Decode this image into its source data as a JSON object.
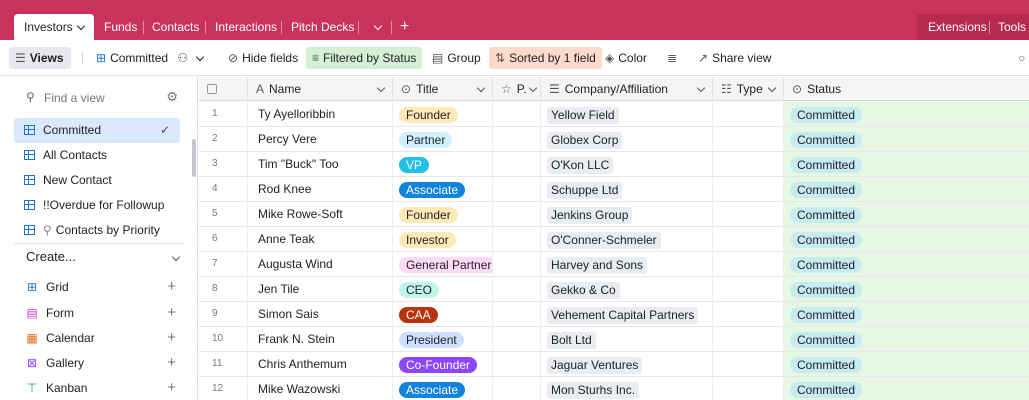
{
  "tabs": {
    "active": "Investors",
    "items": [
      "Funds",
      "Contacts",
      "Interactions",
      "Pitch Decks"
    ],
    "add": "+",
    "right": [
      "Extensions",
      "Tools"
    ]
  },
  "toolbar": {
    "views": "Views",
    "current_view": "Committed",
    "hide_fields": "Hide fields",
    "filter": "Filtered by Status",
    "group": "Group",
    "sort": "Sorted by 1 field",
    "color": "Color",
    "share": "Share view"
  },
  "sidebar": {
    "search_placeholder": "Find a view",
    "views": [
      {
        "label": "Committed",
        "selected": true
      },
      {
        "label": "All Contacts"
      },
      {
        "label": "New Contact"
      },
      {
        "label": "!!Overdue for Followup"
      },
      {
        "label": "Contacts by Priority"
      }
    ],
    "create_label": "Create...",
    "create_items": [
      {
        "label": "Grid",
        "icon": "grid-icon"
      },
      {
        "label": "Form",
        "icon": "form-icon"
      },
      {
        "label": "Calendar",
        "icon": "calendar-icon"
      },
      {
        "label": "Gallery",
        "icon": "gallery-icon"
      },
      {
        "label": "Kanban",
        "icon": "kanban-icon"
      }
    ]
  },
  "grid": {
    "columns": [
      "Name",
      "Title",
      "P.",
      "Company/Affiliation",
      "Type",
      "Status"
    ],
    "rows": [
      {
        "num": "1",
        "name": "Ty Ayelloribbin",
        "title": "Founder",
        "company": "Yellow Field",
        "status": "Committed"
      },
      {
        "num": "2",
        "name": "Percy Vere",
        "title": "Partner",
        "company": "Globex Corp",
        "status": "Committed"
      },
      {
        "num": "3",
        "name": "Tim \"Buck\" Too",
        "title": "VP",
        "company": "O'Kon LLC",
        "status": "Committed"
      },
      {
        "num": "4",
        "name": "Rod Knee",
        "title": "Associate",
        "company": "Schuppe Ltd",
        "status": "Committed"
      },
      {
        "num": "5",
        "name": "Mike Rowe-Soft",
        "title": "Founder",
        "company": "Jenkins Group",
        "status": "Committed"
      },
      {
        "num": "6",
        "name": "Anne Teak",
        "title": "Investor",
        "company": "O'Conner-Schmeler",
        "status": "Committed"
      },
      {
        "num": "7",
        "name": "Augusta Wind",
        "title": "General Partner",
        "company": "Harvey and Sons",
        "status": "Committed"
      },
      {
        "num": "8",
        "name": "Jen Tile",
        "title": "CEO",
        "company": "Gekko & Co",
        "status": "Committed"
      },
      {
        "num": "9",
        "name": "Simon Sais",
        "title": "CAA",
        "company": "Vehement Capital Partners",
        "status": "Committed"
      },
      {
        "num": "10",
        "name": "Frank N. Stein",
        "title": "President",
        "company": "Bolt Ltd",
        "status": "Committed"
      },
      {
        "num": "11",
        "name": "Chris Anthemum",
        "title": "Co-Founder",
        "company": "Jaguar Ventures",
        "status": "Committed"
      },
      {
        "num": "12",
        "name": "Mike Wazowski",
        "title": "Associate",
        "company": "Mon Sturhs Inc.",
        "status": "Committed"
      }
    ]
  },
  "title_colors": {
    "Founder": {
      "bg": "#ffeab6",
      "fg": "#1d1f25"
    },
    "Partner": {
      "bg": "#d0f0fd",
      "fg": "#1d1f25"
    },
    "VP": {
      "bg": "#20c0e8",
      "fg": "#ffffff"
    },
    "Associate": {
      "bg": "#1283da",
      "fg": "#ffffff"
    },
    "Investor": {
      "bg": "#ffeab6",
      "fg": "#1d1f25"
    },
    "General Partner": {
      "bg": "#ffdaf6",
      "fg": "#1d1f25"
    },
    "CEO": {
      "bg": "#c2f5e9",
      "fg": "#1d1f25"
    },
    "CAA": {
      "bg": "#b8340f",
      "fg": "#ffffff"
    },
    "President": {
      "bg": "#cfdfff",
      "fg": "#1d1f25"
    },
    "Co-Founder": {
      "bg": "#8b46ff",
      "fg": "#ffffff"
    }
  },
  "colors": {
    "tabbar": "#c9325a",
    "status_pill": "#c6ebf0",
    "status_column": "#e6f7e4"
  }
}
